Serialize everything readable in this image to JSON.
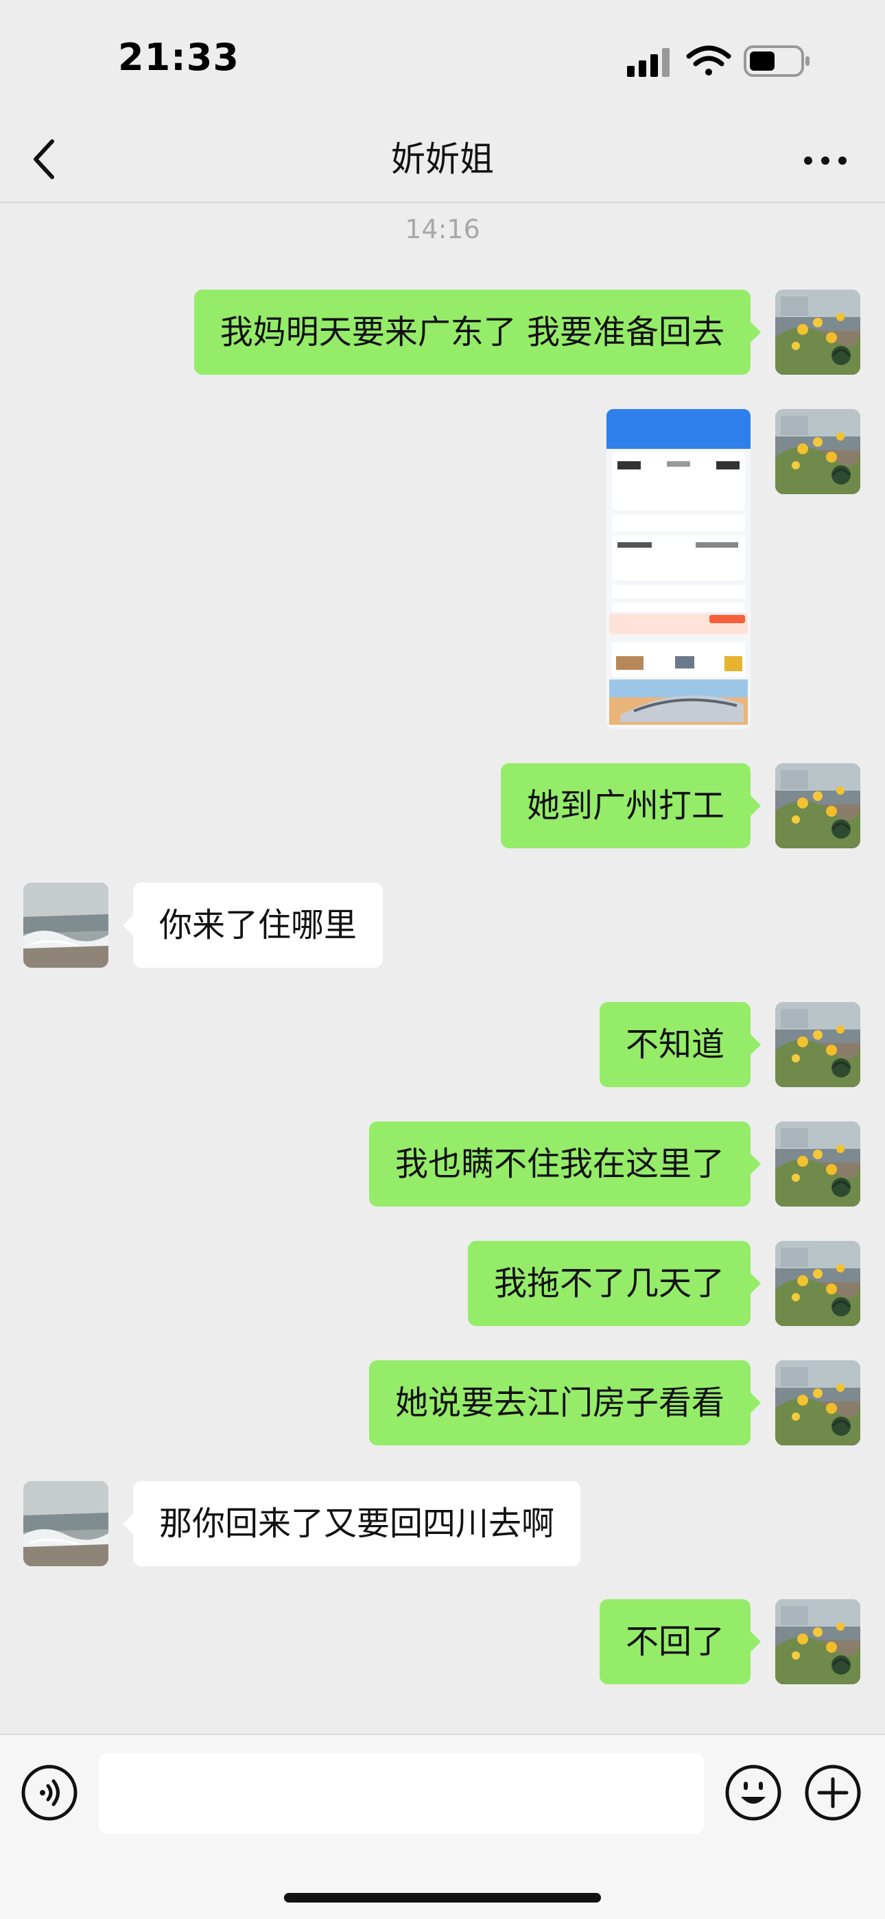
{
  "status_bar": {
    "time": "21:33",
    "icons": [
      "cellular-signal-icon",
      "wifi-icon",
      "battery-icon"
    ]
  },
  "header": {
    "title": "妡妡姐",
    "back_icon": "chevron-left-icon",
    "more_icon": "more-dots-icon"
  },
  "chat": {
    "timestamp": "14:16",
    "messages": [
      {
        "from": "me",
        "type": "text",
        "text": "我妈明天要来广东了 我要准备回去"
      },
      {
        "from": "me",
        "type": "image"
      },
      {
        "from": "me",
        "type": "text",
        "text": "她到广州打工"
      },
      {
        "from": "other",
        "type": "text",
        "text": "你来了住哪里"
      },
      {
        "from": "me",
        "type": "text",
        "text": "不知道"
      },
      {
        "from": "me",
        "type": "text",
        "text": "我也瞒不住我在这里了"
      },
      {
        "from": "me",
        "type": "text",
        "text": "我拖不了几天了"
      },
      {
        "from": "me",
        "type": "text",
        "text": "她说要去江门房子看看"
      },
      {
        "from": "other",
        "type": "text",
        "text": "那你回来了又要回四川去啊"
      },
      {
        "from": "me",
        "type": "text",
        "text": "不回了"
      }
    ]
  },
  "input_bar": {
    "value": "",
    "placeholder": "",
    "voice_icon": "voice-icon",
    "emoji_icon": "emoji-icon",
    "plus_icon": "plus-icon"
  },
  "colors": {
    "background": "#ededed",
    "my_bubble": "#95ec69",
    "other_bubble": "#ffffff",
    "timestamp": "#a8a8a8"
  }
}
